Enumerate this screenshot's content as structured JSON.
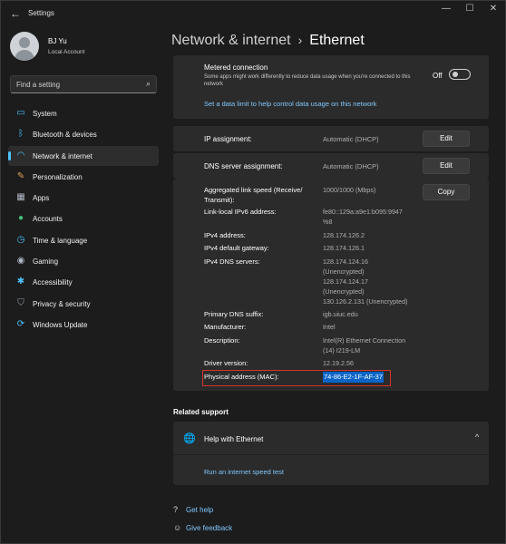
{
  "window": {
    "title": "Settings",
    "back_icon": "←",
    "minimize": "—",
    "maximize": "☐",
    "close": "✕"
  },
  "user": {
    "name": "BJ Yu",
    "account_type": "Local Account"
  },
  "search": {
    "placeholder": "Find a setting",
    "icon": "⌕"
  },
  "sidebar": {
    "items": [
      {
        "label": "System",
        "icon": "system-icon",
        "glyph": "▭",
        "color": "#4cc2ff"
      },
      {
        "label": "Bluetooth & devices",
        "icon": "bluetooth-icon",
        "glyph": "ᛒ",
        "color": "#4cc2ff"
      },
      {
        "label": "Network & internet",
        "icon": "wifi-icon",
        "glyph": "◠",
        "color": "#4cc2ff",
        "selected": true
      },
      {
        "label": "Personalization",
        "icon": "brush-icon",
        "glyph": "✎",
        "color": "#e8a35c"
      },
      {
        "label": "Apps",
        "icon": "apps-icon",
        "glyph": "▦",
        "color": "#b0b8c8"
      },
      {
        "label": "Accounts",
        "icon": "person-icon",
        "glyph": "●",
        "color": "#3fc27a"
      },
      {
        "label": "Time & language",
        "icon": "globe-clock-icon",
        "glyph": "◷",
        "color": "#4cc2ff"
      },
      {
        "label": "Gaming",
        "icon": "gamepad-icon",
        "glyph": "◉",
        "color": "#b0b8c8"
      },
      {
        "label": "Accessibility",
        "icon": "accessibility-icon",
        "glyph": "✱",
        "color": "#4cc2ff"
      },
      {
        "label": "Privacy & security",
        "icon": "shield-icon",
        "glyph": "⛉",
        "color": "#9aa3b0"
      },
      {
        "label": "Windows Update",
        "icon": "update-icon",
        "glyph": "⟳",
        "color": "#4cc2ff"
      }
    ]
  },
  "header": {
    "parent": "Network & internet",
    "separator": "›",
    "current": "Ethernet"
  },
  "metered": {
    "title": "Metered connection",
    "description": "Some apps might work differently to reduce data usage when you're connected to this network",
    "toggle_label": "Off",
    "data_limit_link": "Set a data limit to help control data usage on this network"
  },
  "ip_assignment": {
    "label": "IP assignment:",
    "value": "Automatic (DHCP)",
    "button": "Edit"
  },
  "dns_assignment": {
    "label": "DNS server assignment:",
    "value": "Automatic (DHCP)",
    "button": "Edit"
  },
  "details": {
    "copy_button": "Copy",
    "link_speed_label": "Aggregated link speed (Receive/ Transmit):",
    "link_speed_value": "1000/1000 (Mbps)",
    "ipv6_label": "Link-local IPv6 address:",
    "ipv6_value": "fe80::129a:a9e1:b095:9947 %8",
    "ipv4_label": "IPv4 address:",
    "ipv4_value": "128.174.126.2",
    "gateway_label": "IPv4 default gateway:",
    "gateway_value": "128.174.126.1",
    "dns_label": "IPv4 DNS servers:",
    "dns_value_1": "128.174.124.16",
    "dns_value_2": "(Unencrypted)",
    "dns_value_3": "128.174.124.17",
    "dns_value_4": "(Unencrypted)",
    "dns_value_5": "130.126.2.131 (Unencrypted)",
    "suffix_label": "Primary DNS suffix:",
    "suffix_value": "igb.uiuc.edu",
    "manufacturer_label": "Manufacturer:",
    "manufacturer_value": "Intel",
    "description_label": "Description:",
    "description_value": "Intel(R) Ethernet Connection (14) I219-LM",
    "driver_label": "Driver version:",
    "driver_value": "12.19.2.56",
    "mac_label": "Physical address (MAC):",
    "mac_value": "74-86-E2-1F-AF-37"
  },
  "related": {
    "heading": "Related support",
    "help_title": "Help with Ethernet",
    "speed_test_link": "Run an internet speed test",
    "chevron": "^"
  },
  "footer": {
    "get_help": "Get help",
    "give_feedback": "Give feedback"
  },
  "colors": {
    "accent": "#4cc2ff",
    "link": "#7fc8ff",
    "highlight_box": "#d8332c",
    "selection": "#0a64c8"
  }
}
